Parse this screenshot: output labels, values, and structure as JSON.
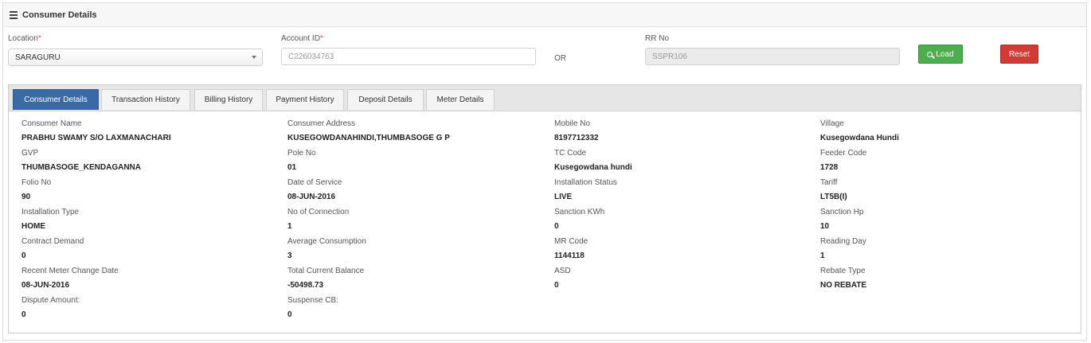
{
  "header": {
    "title": "Consumer Details",
    "menu_icon": "hamburger-menu-icon"
  },
  "form": {
    "location": {
      "label": "Location",
      "required_mark": "*",
      "value": "SARAGURU"
    },
    "account_id": {
      "label": "Account ID",
      "required_mark": "*",
      "value": "C226034763"
    },
    "or_text": "OR",
    "rr_no": {
      "label": "RR No",
      "value": "SSPR106"
    },
    "load_label": "Load",
    "reset_label": "Reset"
  },
  "tabs": [
    {
      "label": "Consumer Details",
      "active": true
    },
    {
      "label": "Transaction History",
      "active": false
    },
    {
      "label": "Billing History",
      "active": false
    },
    {
      "label": "Payment History",
      "active": false
    },
    {
      "label": "Deposit Details",
      "active": false
    },
    {
      "label": "Meter Details",
      "active": false
    }
  ],
  "details": {
    "consumer_name": {
      "label": "Consumer Name",
      "value": "PRABHU SWAMY S/O LAXMANACHARI"
    },
    "consumer_address": {
      "label": "Consumer Address",
      "value": "KUSEGOWDANAHINDI,THUMBASOGE G P"
    },
    "mobile_no": {
      "label": "Mobile No",
      "value": "8197712332"
    },
    "village": {
      "label": "Village",
      "value": "Kusegowdana Hundi"
    },
    "gvp": {
      "label": "GVP",
      "value": "THUMBASOGE_KENDAGANNA"
    },
    "pole_no": {
      "label": "Pole No",
      "value": "01"
    },
    "tc_code": {
      "label": "TC Code",
      "value": "Kusegowdana hundi"
    },
    "feeder_code": {
      "label": "Feeder Code",
      "value": "1728"
    },
    "folio_no": {
      "label": "Folio No",
      "value": "90"
    },
    "date_of_service": {
      "label": "Date of Service",
      "value": "08-JUN-2016"
    },
    "installation_status": {
      "label": "Installation Status",
      "value": "LIVE"
    },
    "tariff": {
      "label": "Tariff",
      "value": "LT5B(I)"
    },
    "installation_type": {
      "label": "Installation Type",
      "value": "HOME"
    },
    "no_of_connection": {
      "label": "No of Connection",
      "value": "1"
    },
    "sanction_kwh": {
      "label": "Sanction KWh",
      "value": "0"
    },
    "sanction_hp": {
      "label": "Sanction Hp",
      "value": "10"
    },
    "contract_demand": {
      "label": "Contract Demand",
      "value": "0"
    },
    "average_consumption": {
      "label": "Average Consumption",
      "value": "3"
    },
    "mr_code": {
      "label": "MR Code",
      "value": "1144118"
    },
    "reading_day": {
      "label": "Reading Day",
      "value": "1"
    },
    "recent_meter_change_date": {
      "label": "Recent Meter Change Date",
      "value": "08-JUN-2016"
    },
    "total_current_balance": {
      "label": "Total Current Balance",
      "value": "-50498.73"
    },
    "asd": {
      "label": "ASD",
      "value": "0"
    },
    "rebate_type": {
      "label": "Rebate Type",
      "value": "NO REBATE"
    },
    "dispute_amount": {
      "label": "Dispute Amount:",
      "value": "0"
    },
    "suspense_cb": {
      "label": "Suspense CB:",
      "value": "0"
    }
  },
  "colors": {
    "accent_tab": "#3a6aa6",
    "load_button": "#4cae4c",
    "reset_button": "#d03b35",
    "required": "#d9534f"
  }
}
